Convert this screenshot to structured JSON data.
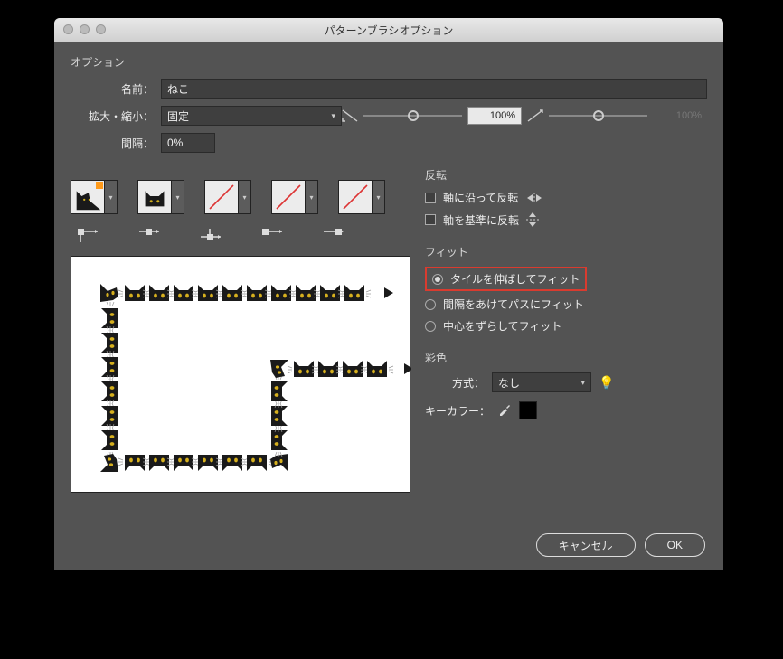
{
  "title": "パターンブラシオプション",
  "options_label": "オプション",
  "fields": {
    "name_label": "名前：",
    "name_value": "ねこ",
    "scale_label": "拡大・縮小：",
    "scale_mode": "固定",
    "scale_value": "100%",
    "scale_value2": "100%",
    "spacing_label": "間隔：",
    "spacing_value": "0%"
  },
  "flip": {
    "header": "反転",
    "along": "軸に沿って反転",
    "across": "軸を基準に反転"
  },
  "fit": {
    "header": "フィット",
    "stretch": "タイルを伸ばしてフィット",
    "space": "間隔をあけてパスにフィット",
    "approx": "中心をずらしてフィット"
  },
  "color": {
    "header": "彩色",
    "method_label": "方式：",
    "method_value": "なし",
    "key_label": "キーカラー："
  },
  "buttons": {
    "cancel": "キャンセル",
    "ok": "OK"
  }
}
